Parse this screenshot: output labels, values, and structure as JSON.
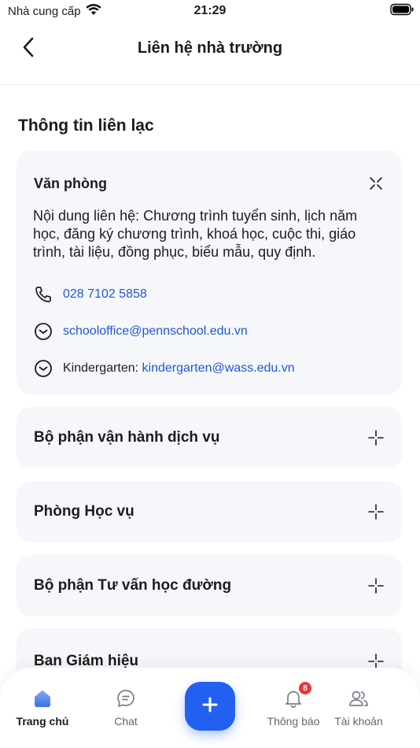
{
  "status_bar": {
    "carrier": "Nhà cung cấp",
    "time": "21:29"
  },
  "nav": {
    "title": "Liên hệ nhà trường"
  },
  "section_title": "Thông tin liên lạc",
  "office": {
    "title": "Văn phòng",
    "description": "Nội dung liên hệ: Chương trình tuyển sinh, lịch năm học, đăng ký chương trình, khoá học, cuộc thi, giáo trình, tài liệu, đồng phục, biểu mẫu, quy định.",
    "phone": "028 7102 5858",
    "email": "schooloffice@pennschool.edu.vn",
    "kg_label": "Kindergarten:",
    "kg_email": "kindergarten@wass.edu.vn"
  },
  "departments": [
    {
      "title": "Bộ phận vận hành dịch vụ"
    },
    {
      "title": "Phòng Học vụ"
    },
    {
      "title": "Bộ phận Tư vấn học đường"
    },
    {
      "title": "Ban Giám hiệu"
    }
  ],
  "tabs": {
    "home": "Trang chủ",
    "chat": "Chat",
    "notifications": "Thông báo",
    "notifications_badge": "8",
    "account": "Tài khoản"
  },
  "colors": {
    "accent": "#2160f0",
    "link": "#2157d6",
    "badge": "#e5393b",
    "card_bg": "#f6f7fb"
  }
}
